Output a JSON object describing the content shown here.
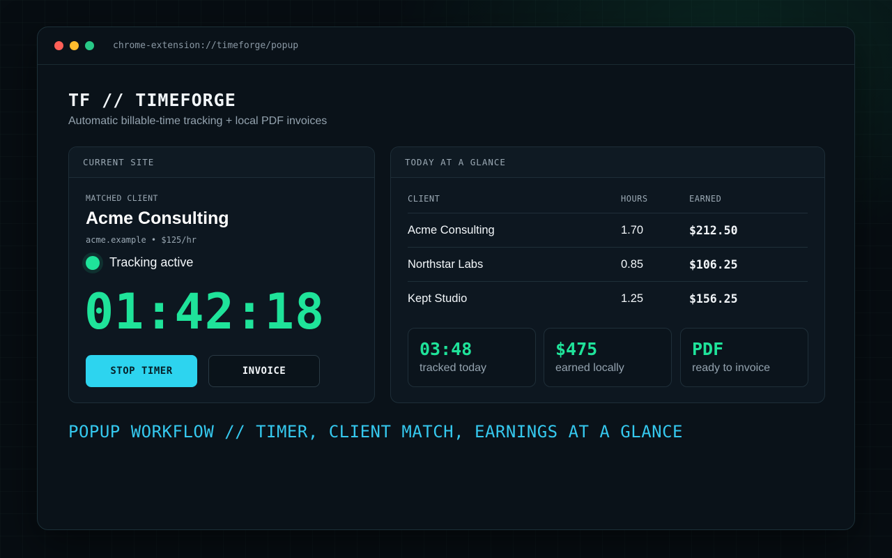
{
  "window": {
    "url": "chrome-extension://timeforge/popup",
    "controls": [
      "close",
      "minimize",
      "maximize"
    ]
  },
  "header": {
    "title": "TF // TIMEFORGE",
    "subtitle": "Automatic billable-time tracking + local PDF invoices"
  },
  "current_site": {
    "heading": "CURRENT SITE",
    "matched_label": "MATCHED CLIENT",
    "client_name": "Acme Consulting",
    "client_meta": "acme.example • $125/hr",
    "status": "Tracking active",
    "timer": "01:42:18",
    "stop_button": "STOP TIMER",
    "invoice_button": "INVOICE"
  },
  "glance": {
    "heading": "TODAY AT A GLANCE",
    "columns": [
      "CLIENT",
      "HOURS",
      "EARNED"
    ],
    "rows": [
      {
        "client": "Acme Consulting",
        "hours": "1.70",
        "earned": "$212.50"
      },
      {
        "client": "Northstar Labs",
        "hours": "0.85",
        "earned": "$106.25"
      },
      {
        "client": "Kept Studio",
        "hours": "1.25",
        "earned": "$156.25"
      }
    ],
    "stats": [
      {
        "value": "03:48",
        "label": "tracked today"
      },
      {
        "value": "$475",
        "label": "earned locally"
      },
      {
        "value": "PDF",
        "label": "ready to invoice"
      }
    ]
  },
  "footer": {
    "caption": "POPUP WORKFLOW // TIMER, CLIENT MATCH, EARNINGS AT A GLANCE"
  },
  "colors": {
    "accent_green": "#1fe39a",
    "accent_cyan": "#2dd4ef",
    "background": "#070d12"
  }
}
